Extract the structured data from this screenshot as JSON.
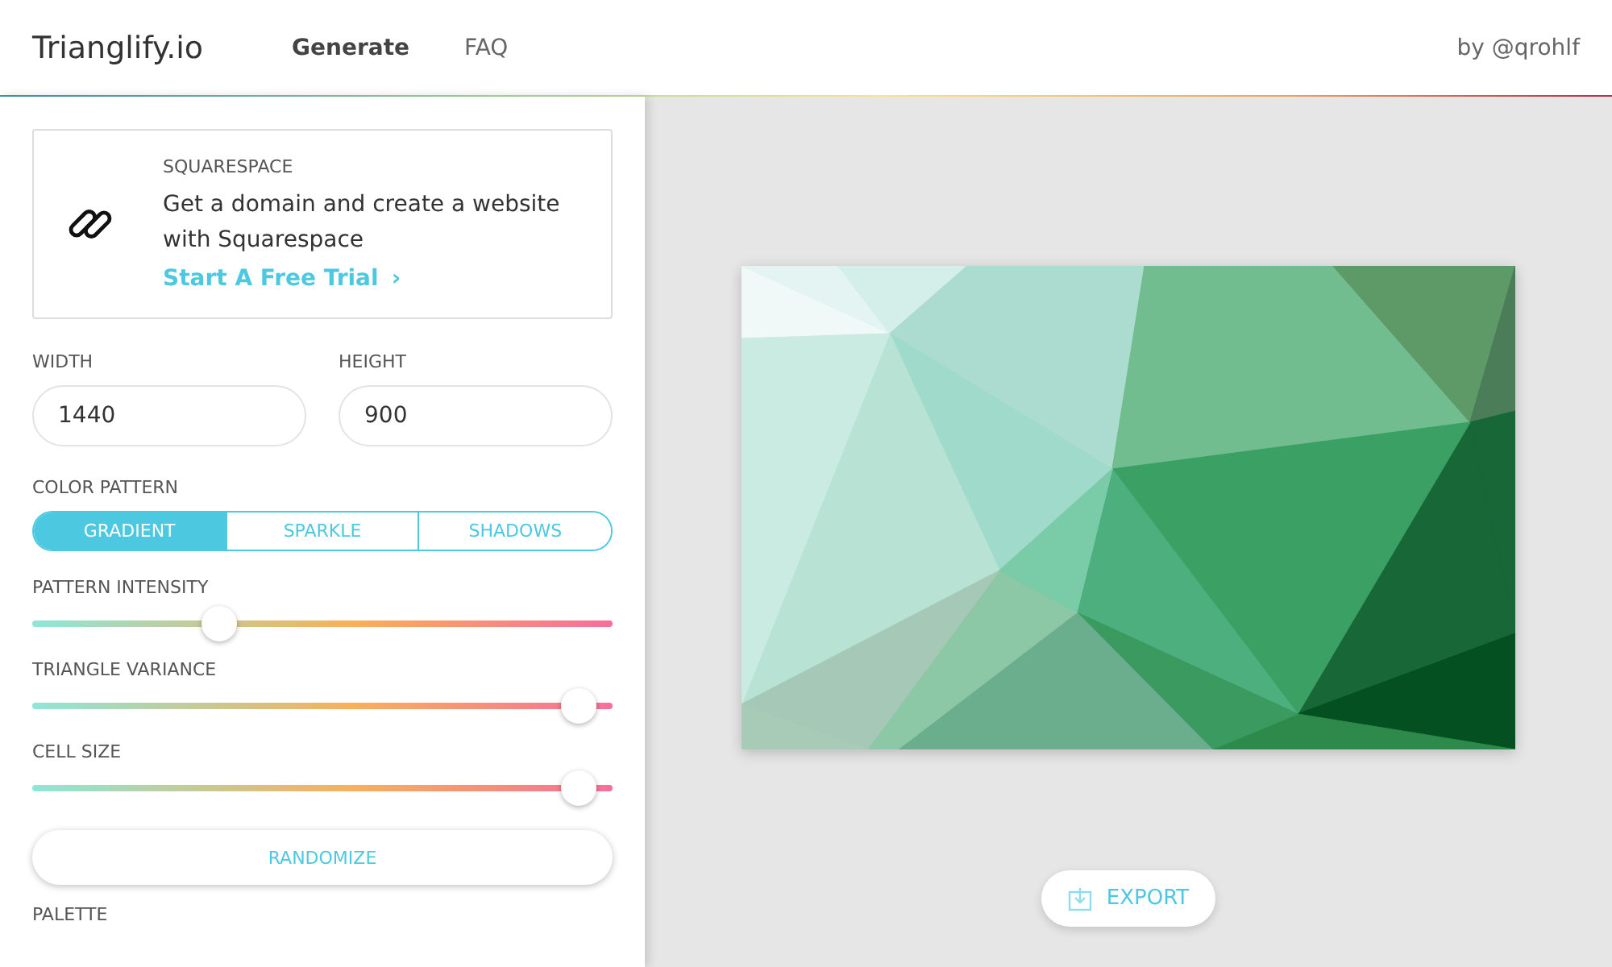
{
  "header": {
    "logo": "Trianglify.io",
    "nav": [
      {
        "label": "Generate",
        "selected": true
      },
      {
        "label": "FAQ",
        "selected": false
      }
    ],
    "credit": "by @qrohlf"
  },
  "ad": {
    "brand": "SQUARESPACE",
    "text": "Get a domain and create a website with Squarespace",
    "cta": "Start A Free Trial",
    "cta_arrow": "›"
  },
  "size": [
    {
      "label": "WIDTH",
      "value": "1440"
    },
    {
      "label": "HEIGHT",
      "value": "900"
    }
  ],
  "color_pattern": {
    "label": "COLOR PATTERN",
    "options": [
      {
        "label": "GRADIENT",
        "selected": true
      },
      {
        "label": "SPARKLE",
        "selected": false
      },
      {
        "label": "SHADOWS",
        "selected": false
      }
    ]
  },
  "sliders": [
    {
      "label": "PATTERN INTENSITY",
      "level": 0.31
    },
    {
      "label": "TRIANGLE VARIANCE",
      "level": 0.97
    },
    {
      "label": "CELL SIZE",
      "level": 0.97
    }
  ],
  "randomize": "RANDOMIZE",
  "palette_label": "PALETTE",
  "export": "EXPORT"
}
